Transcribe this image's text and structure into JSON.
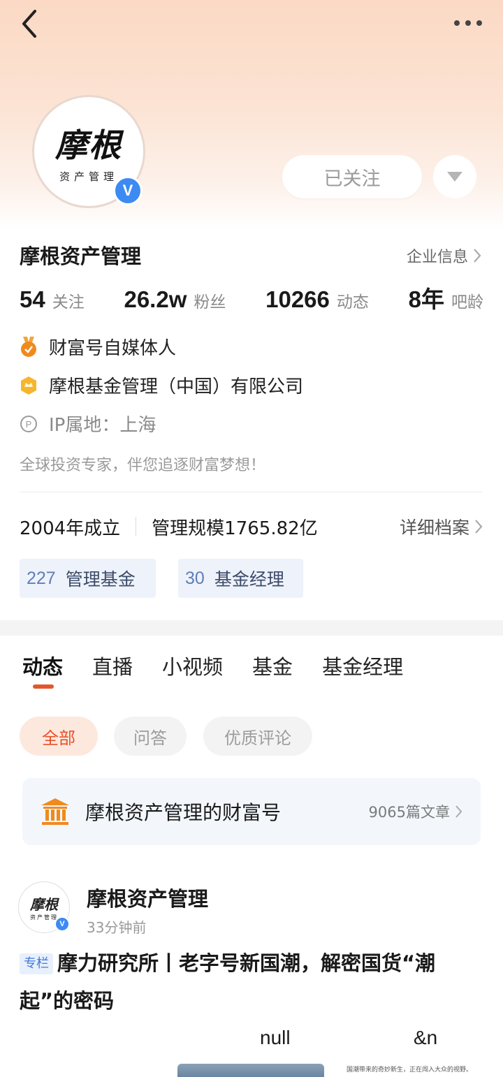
{
  "profile": {
    "name": "摩根资产管理",
    "avatar_logo": "摩根",
    "avatar_sub": "资产管理",
    "verified_mark": "V",
    "follow_label": "已关注",
    "company_info_label": "企业信息"
  },
  "stats": [
    {
      "value": "54",
      "label": "关注"
    },
    {
      "value": "26.2w",
      "label": "粉丝"
    },
    {
      "value": "10266",
      "label": "动态"
    },
    {
      "value": "8年",
      "label": "吧龄"
    }
  ],
  "info": {
    "media_label": "财富号自媒体人",
    "company_label": "摩根基金管理（中国）有限公司",
    "ip_label": "IP属地：上海",
    "bio": "全球投资专家，伴您追逐财富梦想！"
  },
  "fund": {
    "founded": "2004年成立",
    "scale": "管理规模1765.82亿",
    "detail_label": "详细档案",
    "tags": [
      {
        "num": "227",
        "label": "管理基金"
      },
      {
        "num": "30",
        "label": "基金经理"
      }
    ]
  },
  "tabs": [
    "动态",
    "直播",
    "小视频",
    "基金",
    "基金经理"
  ],
  "filters": [
    "全部",
    "问答",
    "优质评论"
  ],
  "wealth_card": {
    "title": "摩根资产管理的财富号",
    "count": "9065篇文章"
  },
  "post": {
    "author": "摩根资产管理",
    "time": "33分钟前",
    "badge": "专栏",
    "title": "摩力研究所丨老字号新国潮，解密国货“潮起”的密码",
    "stray_1": "null",
    "stray_2": "&n",
    "image_text": "国潮带来的奇妙新生，正在闯入大众的视野。"
  },
  "colors": {
    "accent": "#e1582a",
    "verified": "#3d8af2",
    "tag_bg": "#eef2fa",
    "wealth_icon": "#f08a1d"
  }
}
